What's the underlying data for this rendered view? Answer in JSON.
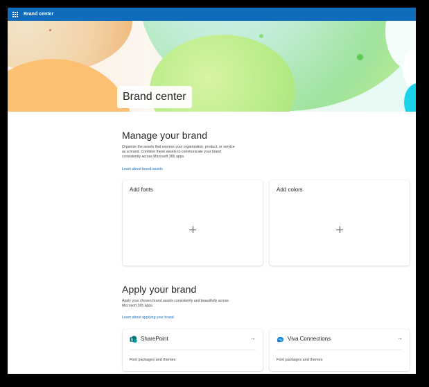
{
  "suite_bar": {
    "title": "Brand center",
    "waffle_icon": "app-launcher-icon"
  },
  "hero": {
    "title": "Brand center"
  },
  "manage": {
    "heading": "Manage your brand",
    "description": "Organize the assets that express your organization, product, or service as a brand. Combine these assets to communicate your brand consistently across Microsoft 365 apps.",
    "link": "Learn about brand assets",
    "cards": [
      {
        "title": "Add fonts",
        "icon": "add-icon"
      },
      {
        "title": "Add colors",
        "icon": "add-icon"
      }
    ]
  },
  "apply": {
    "heading": "Apply your brand",
    "description": "Apply your chosen brand assets consistently and beautifully across Microsoft 365 apps.",
    "link": "Learn about applying your brand",
    "cards": [
      {
        "title": "SharePoint",
        "subtitle": "Font packages and themes",
        "icon": "sharepoint-icon"
      },
      {
        "title": "Viva Connections",
        "subtitle": "Font packages and themes",
        "icon": "viva-connections-icon"
      }
    ],
    "arrow_glyph": "→"
  },
  "colors": {
    "suite_bar": "#0f6cbd",
    "link": "#0f6cbd",
    "frame": "#000000"
  }
}
